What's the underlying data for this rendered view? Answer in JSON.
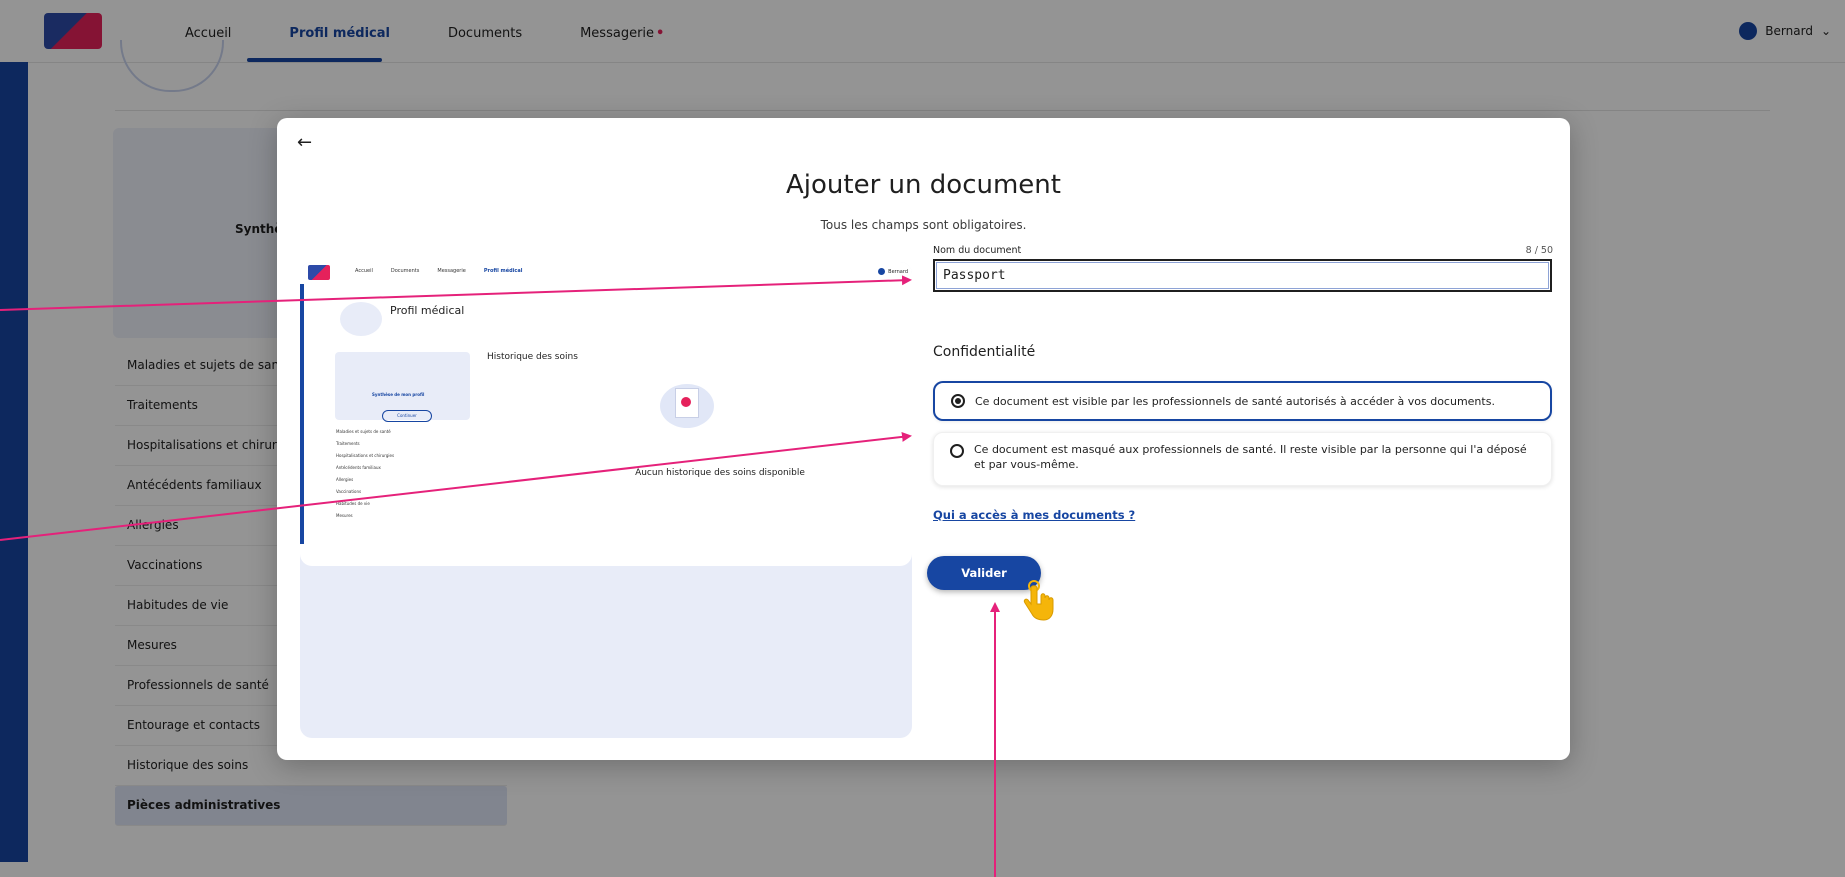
{
  "background": {
    "nav": {
      "items": [
        "Accueil",
        "Profil médical",
        "Documents",
        "Messagerie"
      ],
      "active": "Profil médical",
      "notification_dot": "•"
    },
    "user_label": "Bernard",
    "synthesis_title": "Synthèse",
    "sidebar_items": [
      "Maladies et sujets de santé",
      "Traitements",
      "Hospitalisations et chirurgies",
      "Antécédents familiaux",
      "Allergies",
      "Vaccinations",
      "Habitudes de vie",
      "Mesures",
      "Professionnels de santé",
      "Entourage et contacts",
      "Historique des soins",
      "Pièces administratives"
    ]
  },
  "modal": {
    "back_icon": "arrow-left-icon",
    "title": "Ajouter un document",
    "subtitle": "Tous les champs sont obligatoires.",
    "preview": {
      "nav": [
        "Accueil",
        "Documents",
        "Messagerie",
        "Profil médical"
      ],
      "title": "Profil médical",
      "synthesis_title": "Synthèse de mon profil",
      "synthesis_button": "Continuer",
      "history_title": "Historique des soins",
      "empty_title": "Aucun historique des soins disponible",
      "list": [
        "Maladies et sujets de santé",
        "Traitements",
        "Hospitalisations et chirurgies",
        "Antécédents familiaux",
        "Allergies",
        "Vaccinations",
        "Habitudes de vie",
        "Mesures"
      ]
    },
    "form": {
      "doc_name_label": "Nom du document",
      "doc_name_counter": "8 / 50",
      "doc_name_value": "Passport",
      "confidentiality_title": "Confidentialité",
      "options": [
        {
          "label": "Ce document est visible par les professionnels de santé autorisés à accéder à vos documents.",
          "selected": true
        },
        {
          "label": "Ce document est masqué aux professionnels de santé. Il reste visible par la personne qui l'a déposé et par vous-même.",
          "selected": false
        }
      ],
      "access_link": "Qui a accès à mes documents ?",
      "submit_label": "Valider"
    }
  },
  "colors": {
    "brand_blue": "#1746a2",
    "annotation_pink": "#e5217a",
    "cursor_yellow": "#f5b50a"
  }
}
